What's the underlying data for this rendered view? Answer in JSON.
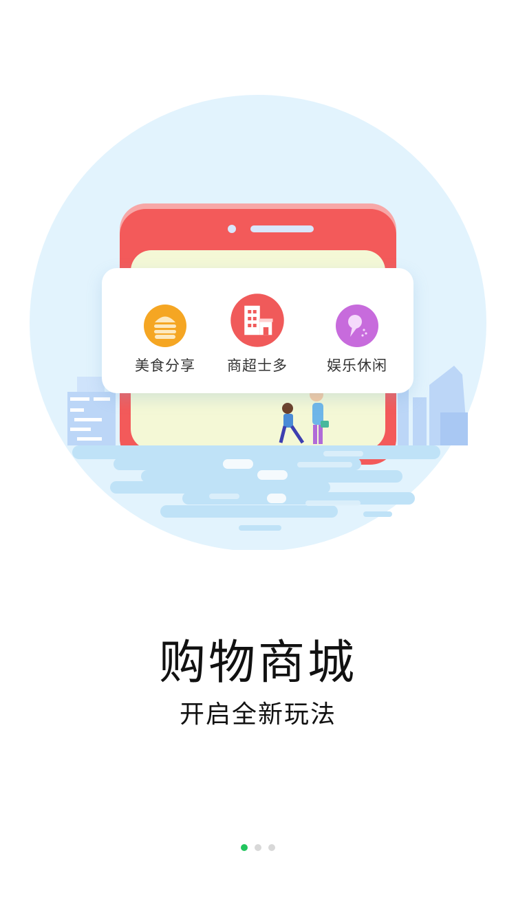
{
  "hero": {
    "categories": [
      {
        "label": "美食分享",
        "icon": "burger-icon",
        "color": "#f5a623"
      },
      {
        "label": "商超士多",
        "icon": "store-building-icon",
        "color": "#f05a5a"
      },
      {
        "label": "娱乐休闲",
        "icon": "ice-cream-icon",
        "color": "#c76bdc"
      }
    ]
  },
  "title": "购物商城",
  "subtitle": "开启全新玩法",
  "pagination": {
    "count": 3,
    "active_index": 0,
    "active_color": "#22c55e"
  },
  "colors": {
    "phone": "#f35a5a",
    "screen": "#f4f8d6",
    "circle": "#e2f3fd",
    "water": "#bfe2f7"
  }
}
